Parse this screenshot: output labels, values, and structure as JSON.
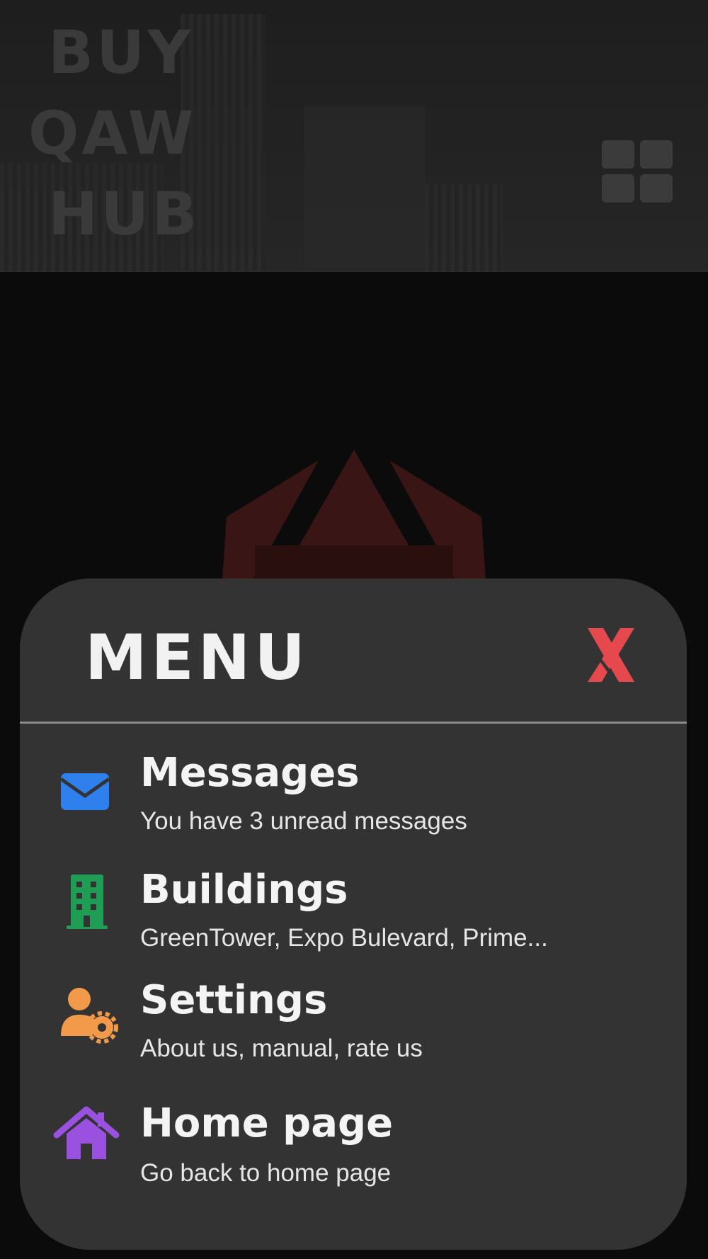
{
  "header": {
    "logo_lines": [
      "BUY",
      "QAW",
      "HUB"
    ],
    "grid_icon": "grid-menu-icon"
  },
  "menu": {
    "title": "MENU",
    "close_label": "X",
    "colors": {
      "panel": "#333333",
      "close": "#e5484d"
    },
    "items": [
      {
        "title": "Messages",
        "subtitle": "You have 3 unread messages",
        "icon": "envelope-icon",
        "color": "#2f80ed"
      },
      {
        "title": "Buildings",
        "subtitle": "GreenTower, Expo Bulevard, Prime...",
        "icon": "building-icon",
        "color": "#1f9d55"
      },
      {
        "title": "Settings",
        "subtitle": "About us, manual, rate us",
        "icon": "user-gear-icon",
        "color": "#f2994a"
      },
      {
        "title": "Home page",
        "subtitle": "Go back to home page",
        "icon": "house-icon",
        "color": "#9b51e0"
      }
    ]
  }
}
